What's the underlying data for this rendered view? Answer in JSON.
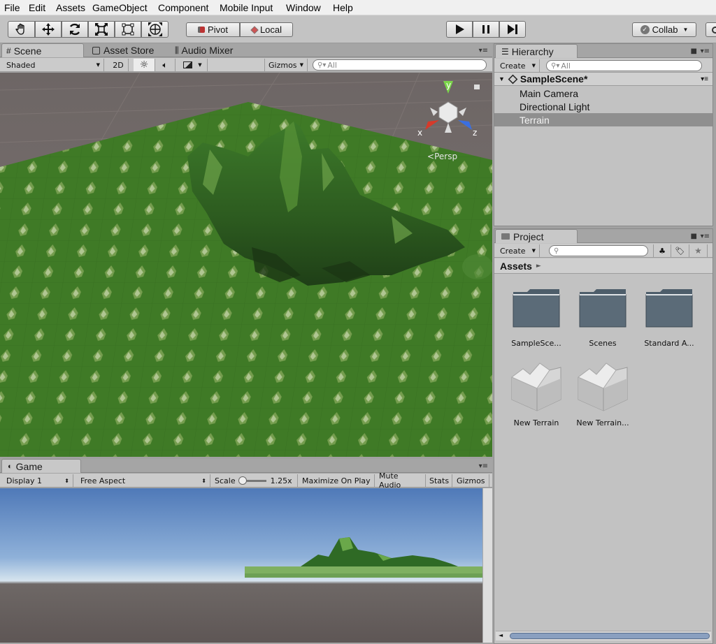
{
  "menu": [
    "File",
    "Edit",
    "Assets",
    "GameObject",
    "Component",
    "Mobile Input",
    "Window",
    "Help"
  ],
  "toolbar": {
    "tools": [
      "hand-tool-icon",
      "move-tool-icon",
      "rotate-tool-icon",
      "scale-tool-icon",
      "rect-tool-icon",
      "transform-tool-icon"
    ],
    "pivot_label": "Pivot",
    "local_label": "Local",
    "collab_label": "Collab"
  },
  "scene": {
    "tabs": [
      "Scene",
      "Asset Store",
      "Audio Mixer"
    ],
    "shading": "Shaded",
    "mode_2d": "2D",
    "gizmos": "Gizmos",
    "search_placeholder": "All",
    "gizmo_axes": {
      "x": "x",
      "y": "y",
      "z": "z"
    },
    "persp_label": "Persp"
  },
  "hierarchy": {
    "tab": "Hierarchy",
    "create": "Create",
    "search_placeholder": "All",
    "scene_name": "SampleScene*",
    "items": [
      "Main Camera",
      "Directional Light",
      "Terrain"
    ],
    "selected": "Terrain"
  },
  "project": {
    "tab": "Project",
    "create": "Create",
    "breadcrumb": "Assets",
    "assets": [
      {
        "name": "SampleSce...",
        "type": "folder"
      },
      {
        "name": "Scenes",
        "type": "folder"
      },
      {
        "name": "Standard A...",
        "type": "folder"
      },
      {
        "name": "New Terrain",
        "type": "terrain"
      },
      {
        "name": "New Terrain...",
        "type": "terrain"
      }
    ]
  },
  "game": {
    "tab": "Game",
    "display": "Display 1",
    "aspect": "Free Aspect",
    "scale_label": "Scale",
    "scale_value": "1.25x",
    "maximize": "Maximize On Play",
    "mute": "Mute Audio",
    "stats": "Stats",
    "gizmos": "Gizmos"
  },
  "colors": {
    "accent_green": "#4a7d2b",
    "selection_gray": "#8f8f8f",
    "sky_blue": "#5e86c2"
  }
}
